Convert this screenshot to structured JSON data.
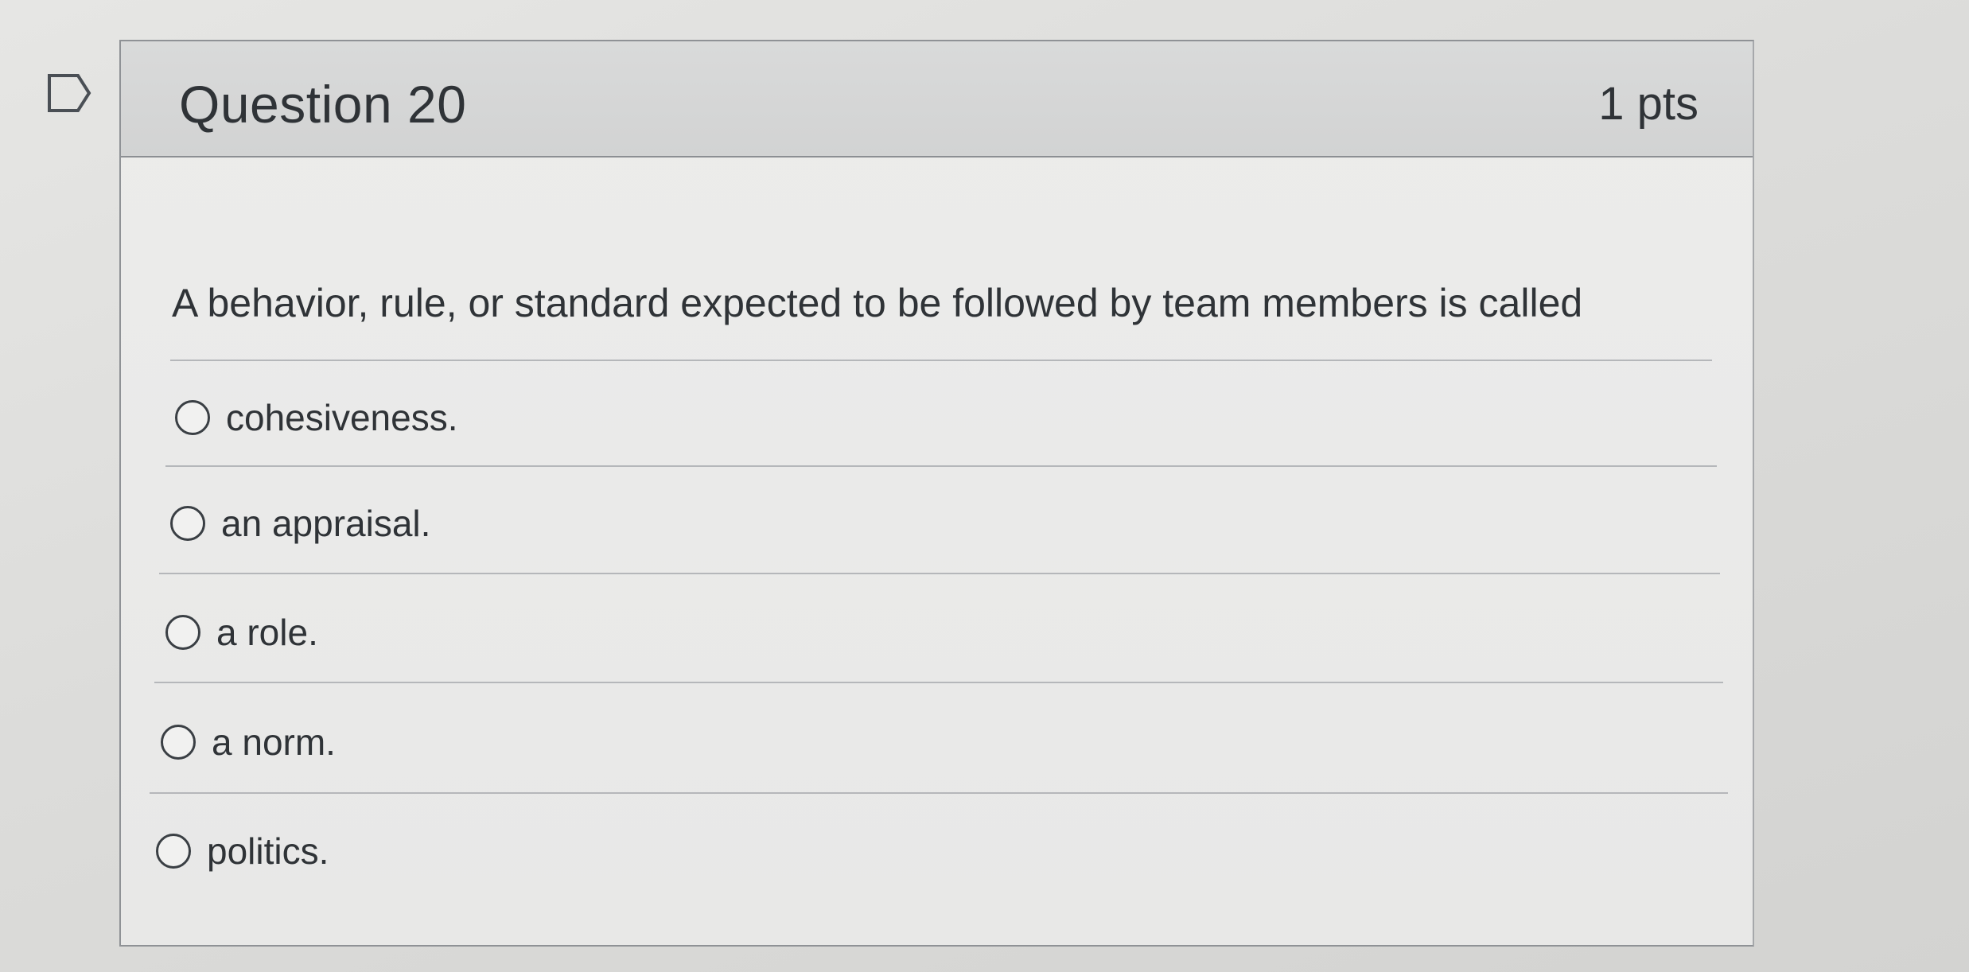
{
  "question": {
    "title": "Question 20",
    "points": "1 pts",
    "prompt": "A behavior, rule, or standard expected to be followed by team members is called",
    "flag_icon": "flag-outline-icon",
    "answers": [
      {
        "label": "cohesiveness.",
        "selected": false
      },
      {
        "label": "an appraisal.",
        "selected": false
      },
      {
        "label": "a role.",
        "selected": false
      },
      {
        "label": "a norm.",
        "selected": false
      },
      {
        "label": "politics.",
        "selected": false
      }
    ]
  },
  "colors": {
    "border": "#8f9296",
    "header_bg": "#d6d7d7",
    "text": "#2f3337",
    "divider": "#b5b7ba"
  }
}
